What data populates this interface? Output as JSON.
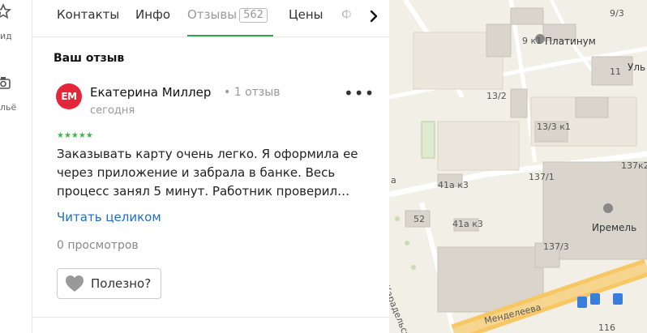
{
  "rail": {
    "labels": [
      "ид",
      "льё"
    ]
  },
  "tabs": {
    "items": [
      {
        "label": "Контакты"
      },
      {
        "label": "Инфо"
      },
      {
        "label": "Отзывы",
        "count": "562",
        "active": true
      },
      {
        "label": "Цены"
      },
      {
        "label": "Ф"
      }
    ]
  },
  "section_title": "Ваш отзыв",
  "review": {
    "avatar_initials": "ЕМ",
    "author": "Екатерина Миллер",
    "author_meta": "• 1 отзыв",
    "date": "сегодня",
    "stars": "★★★★★",
    "rating": 5,
    "text_lines": [
      "Заказывать карту очень легко. Я оформила ее",
      "через приложение и забрала в банке. Весь",
      "процесс занял 5 минут. Работник проверил…"
    ],
    "read_more": "Читать целиком",
    "views": "0 просмотров",
    "useful_label": "Полезно?"
  },
  "map": {
    "labels": [
      {
        "text": "9/3",
        "kind": "house"
      },
      {
        "text": "9 к1",
        "kind": "house"
      },
      {
        "text": "Платинум",
        "kind": "poi"
      },
      {
        "text": "Уль",
        "kind": "poi"
      },
      {
        "text": "11",
        "kind": "house"
      },
      {
        "text": "13/2",
        "kind": "house"
      },
      {
        "text": "13/3 к1",
        "kind": "house"
      },
      {
        "text": "137/1",
        "kind": "house"
      },
      {
        "text": "137к2",
        "kind": "house"
      },
      {
        "text": "41а к3",
        "kind": "house"
      },
      {
        "text": "а",
        "kind": "house"
      },
      {
        "text": "52",
        "kind": "house"
      },
      {
        "text": "41а к3",
        "kind": "house"
      },
      {
        "text": "Иремель",
        "kind": "poi"
      },
      {
        "text": "137/3",
        "kind": "house"
      },
      {
        "text": "Карадельская",
        "kind": "street"
      },
      {
        "text": "Менделеева",
        "kind": "street"
      },
      {
        "text": "116",
        "kind": "house"
      }
    ]
  }
}
